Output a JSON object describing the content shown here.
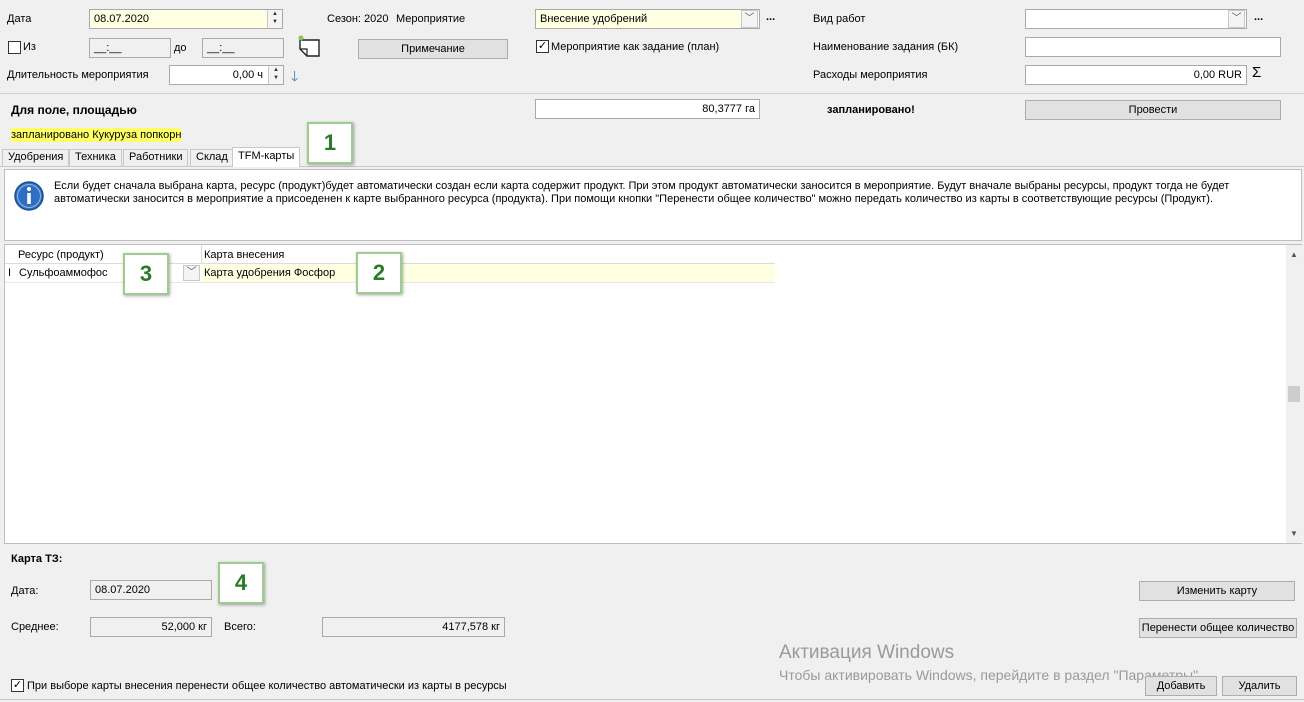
{
  "top": {
    "date_label": "Дата",
    "date_value": "08.07.2020",
    "from_label": "Из",
    "time_from": "__:__",
    "to_label": "до",
    "time_to": "__:__",
    "duration_label": "Длительность мероприятия",
    "duration_value": "0,00 ч",
    "season_label": "Сезон: 2020",
    "event_label": "Мероприятие",
    "event_value": "Внесение удобрений",
    "more": "...",
    "note_button": "Примечание",
    "event_as_task_label": "Мероприятие как задание (план)",
    "work_type_label": "Вид работ",
    "work_type_value": "",
    "task_name_label": "Наименование задания (БК)",
    "task_name_value": "",
    "expenses_label": "Расходы мероприятия",
    "expenses_value": "0,00 RUR",
    "sigma": "Σ"
  },
  "field_band": {
    "field_area_label": "Для поле, площадью",
    "area_value": "80,3777 га",
    "planned_label": "запланировано!",
    "post_button": "Провести",
    "planned_crop": "запланировано Кукуруза попкорн"
  },
  "tabs": [
    {
      "label": "Удобрения"
    },
    {
      "label": "Техника"
    },
    {
      "label": "Работники"
    },
    {
      "label": "Склад"
    },
    {
      "label": "TFM-карты"
    }
  ],
  "info_text": "Если будет сначала выбрана карта, ресурс (продукт)будет автоматически создан если карта содержит продукт. При этом продукт автоматически заносится в мероприятие. Будут вначале выбраны ресурсы, продукт тогда не будет автоматически заносится в мероприятие а присоеденен к карте выбранного ресурса (продукта). При помощи кнопки \"Перенести общее количество\" можно передать количество из карты в соответствующие ресурсы (Продукт).",
  "grid": {
    "columns": [
      "Ресурс (продукт)",
      "Карта внесения"
    ],
    "rows": [
      {
        "resource": "Сульфоаммофос",
        "card": "Карта удобрения Фосфор"
      }
    ]
  },
  "tz_card": {
    "title": "Карта ТЗ:",
    "date_label": "Дата:",
    "date_value": "08.07.2020",
    "avg_label": "Среднее:",
    "avg_value": "52,000 кг",
    "total_label": "Всего:",
    "total_value": "4177,578 кг",
    "change_button": "Изменить карту",
    "transfer_button": "Перенести общее количество"
  },
  "footer": {
    "auto_transfer_label": "При выборе карты внесения перенести общее количество автоматически из карты в ресурсы",
    "add_button": "Добавить",
    "delete_button": "Удалить"
  },
  "watermark": {
    "title": "Активация Windows",
    "subtitle": "Чтобы активировать Windows, перейдите в раздел \"Параметры\"."
  },
  "callouts": [
    "1",
    "2",
    "3",
    "4"
  ]
}
